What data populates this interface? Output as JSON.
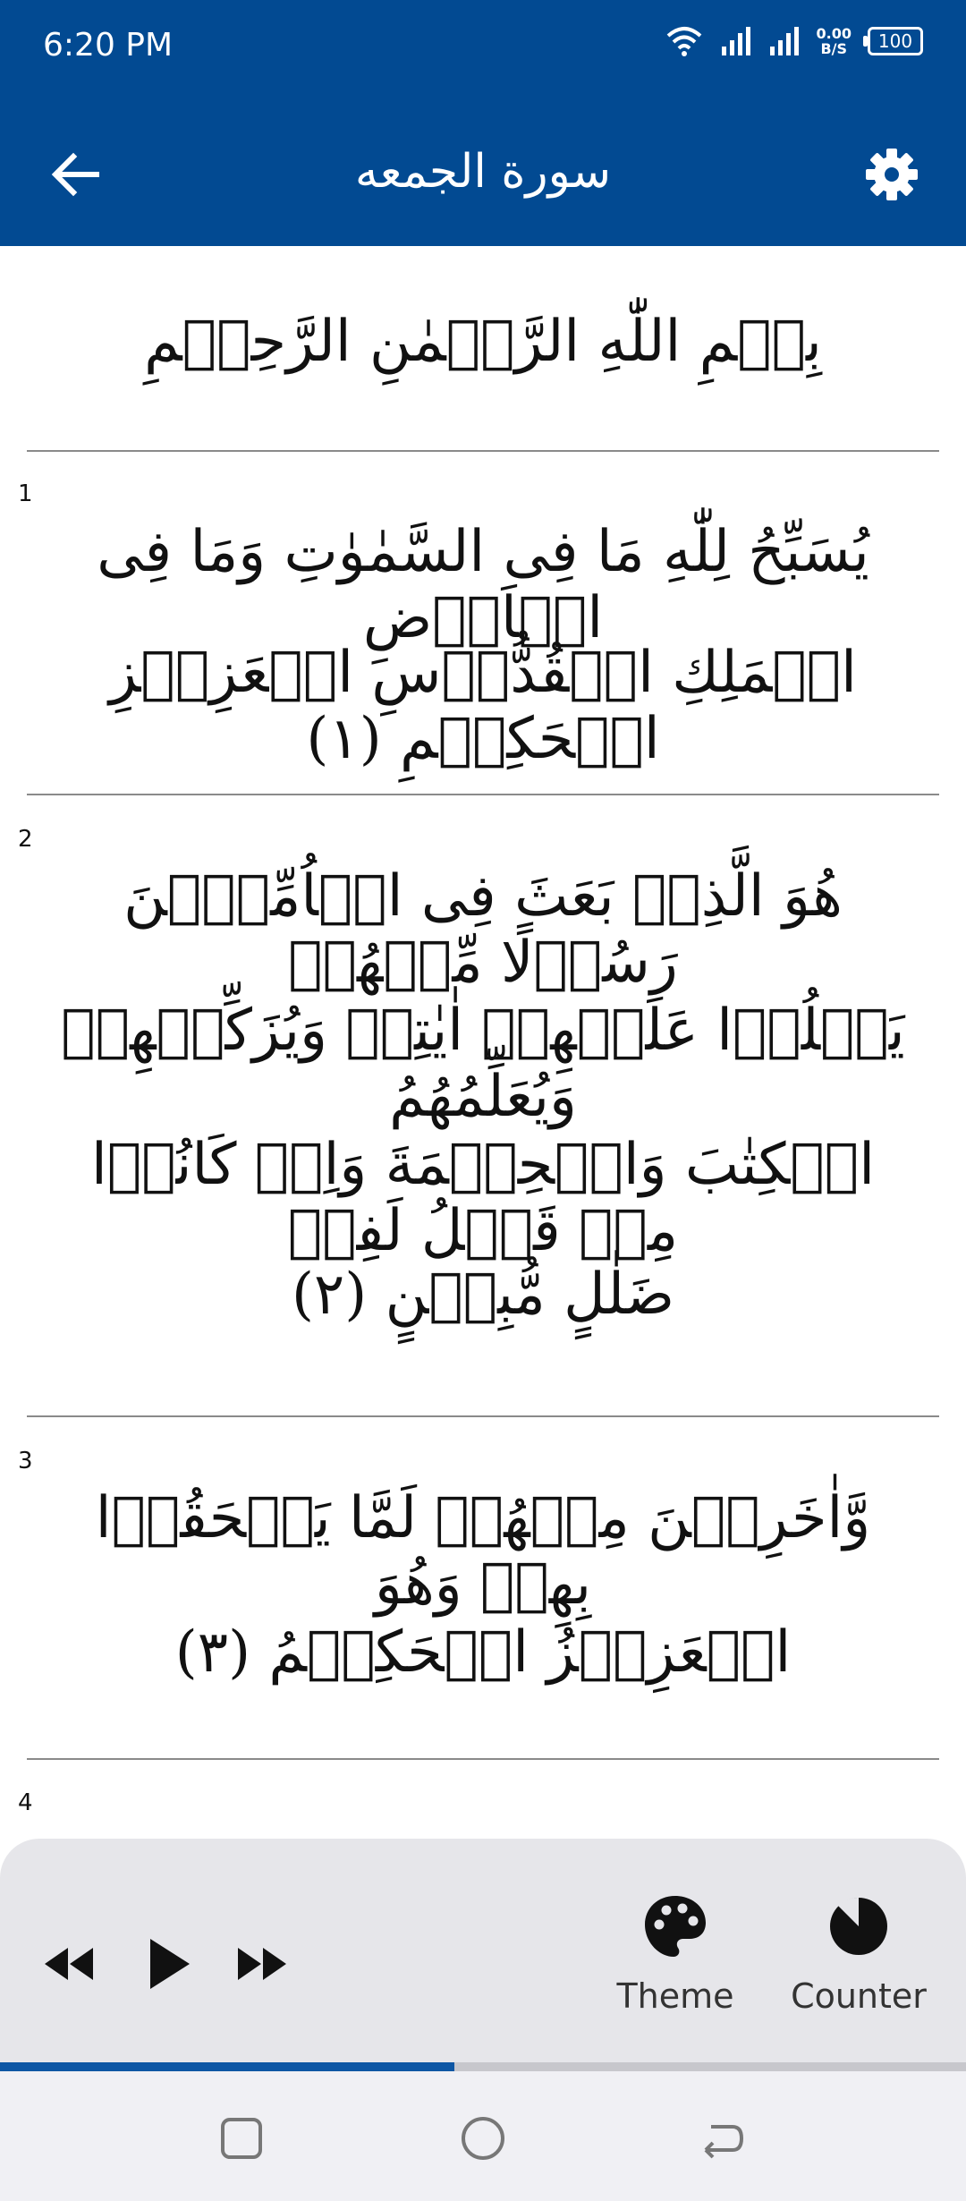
{
  "status": {
    "time": "6:20 PM",
    "net_speed_value": "0.00",
    "net_speed_unit": "B/S",
    "battery": "100"
  },
  "appbar": {
    "title": "سورة الجمعه"
  },
  "bismillah": "بِسۡمِ اللّٰهِ الرَّحۡمٰنِ الرَّحِيۡمِ",
  "ayahs": [
    {
      "number": "1",
      "lines": [
        "يُسَبِّحُ لِلّٰهِ مَا فِى السَّمٰوٰتِ وَمَا فِى الۡاَرۡضِ",
        "الۡمَلِكِ الۡقُدُّوۡسِ الۡعَزِيۡزِ الۡحَكِيۡمِ (١)"
      ]
    },
    {
      "number": "2",
      "lines": [
        "هُوَ الَّذِىۡ بَعَثَ فِى الۡاُمِّيّٖنَ رَسُوۡلًا مِّنۡهُمۡ",
        "يَتۡلُوۡا عَلَيۡهِمۡ اٰيٰتِهٖ وَيُزَكِّيۡهِمۡ وَيُعَلِّمُهُمُ",
        "الۡكِتٰبَ وَالۡحِكۡمَةَ وَاِنۡ كَانُوۡا مِنۡ قَبۡلُ لَفِىۡ",
        "ضَلٰلٍ مُّبِيۡنٍ (٢)"
      ]
    },
    {
      "number": "3",
      "lines": [
        "وَّاٰخَرِيۡنَ مِنۡهُمۡ لَمَّا يَلۡحَقُوۡا بِهِمۡ وَهُوَ",
        "الۡعَزِيۡزُ الۡحَكِيۡمُ (٣)"
      ]
    },
    {
      "number": "4",
      "lines": [
        ""
      ]
    }
  ],
  "player": {
    "theme_label": "Theme",
    "counter_label": "Counter",
    "progress_fraction": 0.47
  },
  "colors": {
    "primary": "#024a92",
    "progress": "#0d56a4",
    "player_bg": "#e6e6ea"
  },
  "icons": [
    "back-arrow-icon",
    "settings-gear-icon",
    "rewind-icon",
    "play-icon",
    "fast-forward-icon",
    "palette-icon",
    "pie-counter-icon",
    "recent-apps-icon",
    "home-icon",
    "back-icon"
  ]
}
